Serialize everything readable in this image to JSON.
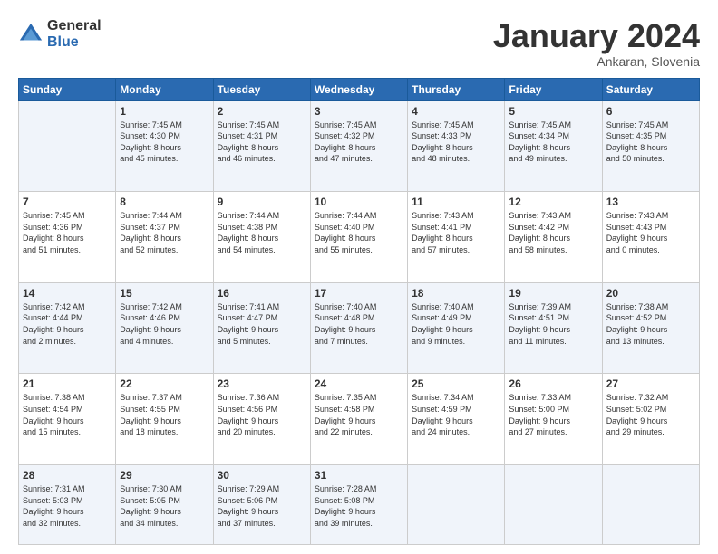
{
  "logo": {
    "general": "General",
    "blue": "Blue"
  },
  "title": "January 2024",
  "subtitle": "Ankaran, Slovenia",
  "days_header": [
    "Sunday",
    "Monday",
    "Tuesday",
    "Wednesday",
    "Thursday",
    "Friday",
    "Saturday"
  ],
  "weeks": [
    [
      {
        "day": "",
        "info": ""
      },
      {
        "day": "1",
        "info": "Sunrise: 7:45 AM\nSunset: 4:30 PM\nDaylight: 8 hours\nand 45 minutes."
      },
      {
        "day": "2",
        "info": "Sunrise: 7:45 AM\nSunset: 4:31 PM\nDaylight: 8 hours\nand 46 minutes."
      },
      {
        "day": "3",
        "info": "Sunrise: 7:45 AM\nSunset: 4:32 PM\nDaylight: 8 hours\nand 47 minutes."
      },
      {
        "day": "4",
        "info": "Sunrise: 7:45 AM\nSunset: 4:33 PM\nDaylight: 8 hours\nand 48 minutes."
      },
      {
        "day": "5",
        "info": "Sunrise: 7:45 AM\nSunset: 4:34 PM\nDaylight: 8 hours\nand 49 minutes."
      },
      {
        "day": "6",
        "info": "Sunrise: 7:45 AM\nSunset: 4:35 PM\nDaylight: 8 hours\nand 50 minutes."
      }
    ],
    [
      {
        "day": "7",
        "info": "Sunrise: 7:45 AM\nSunset: 4:36 PM\nDaylight: 8 hours\nand 51 minutes."
      },
      {
        "day": "8",
        "info": "Sunrise: 7:44 AM\nSunset: 4:37 PM\nDaylight: 8 hours\nand 52 minutes."
      },
      {
        "day": "9",
        "info": "Sunrise: 7:44 AM\nSunset: 4:38 PM\nDaylight: 8 hours\nand 54 minutes."
      },
      {
        "day": "10",
        "info": "Sunrise: 7:44 AM\nSunset: 4:40 PM\nDaylight: 8 hours\nand 55 minutes."
      },
      {
        "day": "11",
        "info": "Sunrise: 7:43 AM\nSunset: 4:41 PM\nDaylight: 8 hours\nand 57 minutes."
      },
      {
        "day": "12",
        "info": "Sunrise: 7:43 AM\nSunset: 4:42 PM\nDaylight: 8 hours\nand 58 minutes."
      },
      {
        "day": "13",
        "info": "Sunrise: 7:43 AM\nSunset: 4:43 PM\nDaylight: 9 hours\nand 0 minutes."
      }
    ],
    [
      {
        "day": "14",
        "info": "Sunrise: 7:42 AM\nSunset: 4:44 PM\nDaylight: 9 hours\nand 2 minutes."
      },
      {
        "day": "15",
        "info": "Sunrise: 7:42 AM\nSunset: 4:46 PM\nDaylight: 9 hours\nand 4 minutes."
      },
      {
        "day": "16",
        "info": "Sunrise: 7:41 AM\nSunset: 4:47 PM\nDaylight: 9 hours\nand 5 minutes."
      },
      {
        "day": "17",
        "info": "Sunrise: 7:40 AM\nSunset: 4:48 PM\nDaylight: 9 hours\nand 7 minutes."
      },
      {
        "day": "18",
        "info": "Sunrise: 7:40 AM\nSunset: 4:49 PM\nDaylight: 9 hours\nand 9 minutes."
      },
      {
        "day": "19",
        "info": "Sunrise: 7:39 AM\nSunset: 4:51 PM\nDaylight: 9 hours\nand 11 minutes."
      },
      {
        "day": "20",
        "info": "Sunrise: 7:38 AM\nSunset: 4:52 PM\nDaylight: 9 hours\nand 13 minutes."
      }
    ],
    [
      {
        "day": "21",
        "info": "Sunrise: 7:38 AM\nSunset: 4:54 PM\nDaylight: 9 hours\nand 15 minutes."
      },
      {
        "day": "22",
        "info": "Sunrise: 7:37 AM\nSunset: 4:55 PM\nDaylight: 9 hours\nand 18 minutes."
      },
      {
        "day": "23",
        "info": "Sunrise: 7:36 AM\nSunset: 4:56 PM\nDaylight: 9 hours\nand 20 minutes."
      },
      {
        "day": "24",
        "info": "Sunrise: 7:35 AM\nSunset: 4:58 PM\nDaylight: 9 hours\nand 22 minutes."
      },
      {
        "day": "25",
        "info": "Sunrise: 7:34 AM\nSunset: 4:59 PM\nDaylight: 9 hours\nand 24 minutes."
      },
      {
        "day": "26",
        "info": "Sunrise: 7:33 AM\nSunset: 5:00 PM\nDaylight: 9 hours\nand 27 minutes."
      },
      {
        "day": "27",
        "info": "Sunrise: 7:32 AM\nSunset: 5:02 PM\nDaylight: 9 hours\nand 29 minutes."
      }
    ],
    [
      {
        "day": "28",
        "info": "Sunrise: 7:31 AM\nSunset: 5:03 PM\nDaylight: 9 hours\nand 32 minutes."
      },
      {
        "day": "29",
        "info": "Sunrise: 7:30 AM\nSunset: 5:05 PM\nDaylight: 9 hours\nand 34 minutes."
      },
      {
        "day": "30",
        "info": "Sunrise: 7:29 AM\nSunset: 5:06 PM\nDaylight: 9 hours\nand 37 minutes."
      },
      {
        "day": "31",
        "info": "Sunrise: 7:28 AM\nSunset: 5:08 PM\nDaylight: 9 hours\nand 39 minutes."
      },
      {
        "day": "",
        "info": ""
      },
      {
        "day": "",
        "info": ""
      },
      {
        "day": "",
        "info": ""
      }
    ]
  ]
}
